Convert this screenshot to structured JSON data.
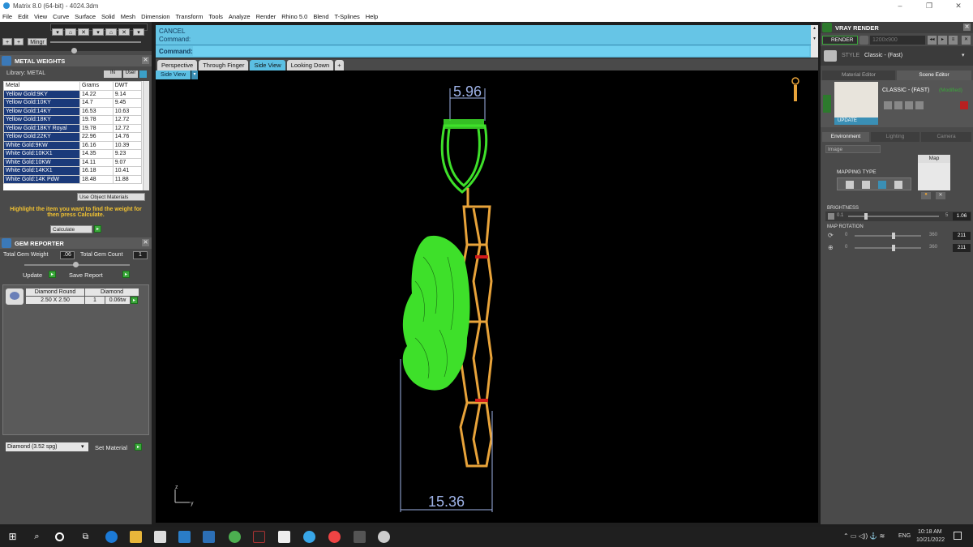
{
  "window": {
    "title": "Matrix 8.0 (64-bit) - 4024.3dm",
    "controls": [
      "–",
      "❐",
      "✕"
    ]
  },
  "menu": [
    "File",
    "Edit",
    "View",
    "Curve",
    "Surface",
    "Solid",
    "Mesh",
    "Dimension",
    "Transform",
    "Tools",
    "Analyze",
    "Render",
    "Rhino 5.0",
    "Blend",
    "T-Splines",
    "Help"
  ],
  "toolbar": {
    "mingr_label": "Mingr"
  },
  "metal_weights": {
    "title": "METAL WEIGHTS",
    "library_label": "Library: METAL",
    "user_label": "User",
    "columns": [
      "Metal",
      "Grams",
      "DWT"
    ],
    "rows": [
      [
        "Yellow Gold:9KY",
        "14.22",
        "9.14"
      ],
      [
        "Yellow Gold:10KY",
        "14.7",
        "9.45"
      ],
      [
        "Yellow Gold:14KY",
        "16.53",
        "10.63"
      ],
      [
        "Yellow Gold:18KY",
        "19.78",
        "12.72"
      ],
      [
        "Yellow Gold:18KY Royal",
        "19.78",
        "12.72"
      ],
      [
        "Yellow Gold:22KY",
        "22.96",
        "14.76"
      ],
      [
        "White Gold:9KW",
        "16.16",
        "10.39"
      ],
      [
        "White Gold:10KX1",
        "14.35",
        "9.23"
      ],
      [
        "White Gold:10KW",
        "14.11",
        "9.07"
      ],
      [
        "White Gold:14KX1",
        "16.18",
        "10.41"
      ],
      [
        "White Gold:14K PdW",
        "18.48",
        "11.88"
      ]
    ],
    "use_object_materials": "Use Object Materials",
    "help_text": "Highlight the item you want to find the weight for then press Calculate.",
    "calculate_label": "Calculate"
  },
  "gem_reporter": {
    "title": "GEM REPORTER",
    "total_weight_label": "Total Gem Weight",
    "total_weight_value": ".06",
    "total_count_label": "Total Gem Count",
    "total_count_value": "1",
    "update_label": "Update",
    "save_report_label": "Save Report",
    "gem": {
      "shape": "Diamond Round",
      "size": "2.50 X 2.50",
      "type": "Diamond",
      "count": "1",
      "weight": "0.06tw"
    }
  },
  "material": {
    "selected": "Diamond   (3.52 spg)",
    "set_label": "Set Material"
  },
  "command": {
    "line1": "CANCEL",
    "line2": "Command:",
    "prompt": "Command:"
  },
  "tabs": [
    "Perspective",
    "Through Finger",
    "Side View",
    "Looking Down"
  ],
  "viewport": {
    "label": "Side View",
    "dim_top": "5.96",
    "dim_bottom": "15.36",
    "axis_z": "z",
    "axis_y": "y"
  },
  "vray": {
    "title": "VRAY RENDER",
    "render_label": "RENDER",
    "resolution": "1200x900",
    "preset_prefix": "STYLE",
    "preset": "Classic - (Fast)",
    "tab_material": "Material Editor",
    "tab_scene": "Scene Editor",
    "scene_name": "CLASSIC - (FAST)",
    "scene_modified": "(Modified)",
    "update_label": "UPDATE",
    "subtabs": [
      "Environment",
      "Lighting",
      "Camera"
    ],
    "env_select": "Image",
    "map_label": "Map",
    "mapping_type": "MAPPING TYPE",
    "brightness_label": "BRIGHTNESS",
    "brightness_min": "0.1",
    "brightness_max": "5",
    "brightness_value": "1.06",
    "map_rotation_label": "MAP ROTATION",
    "rot1_min": "0",
    "rot1_max": "360",
    "rot1_value": "211",
    "rot2_min": "0",
    "rot2_max": "360",
    "rot2_value": "211"
  },
  "taskbar": {
    "lang": "ENG",
    "time": "10:18 AM",
    "date": "10/21/2022"
  },
  "colors": {
    "accent_cyan": "#5bbfe3",
    "model_green": "#3ee02a",
    "model_gold": "#e8a33a",
    "dimension_blue": "#9fb3e8"
  }
}
